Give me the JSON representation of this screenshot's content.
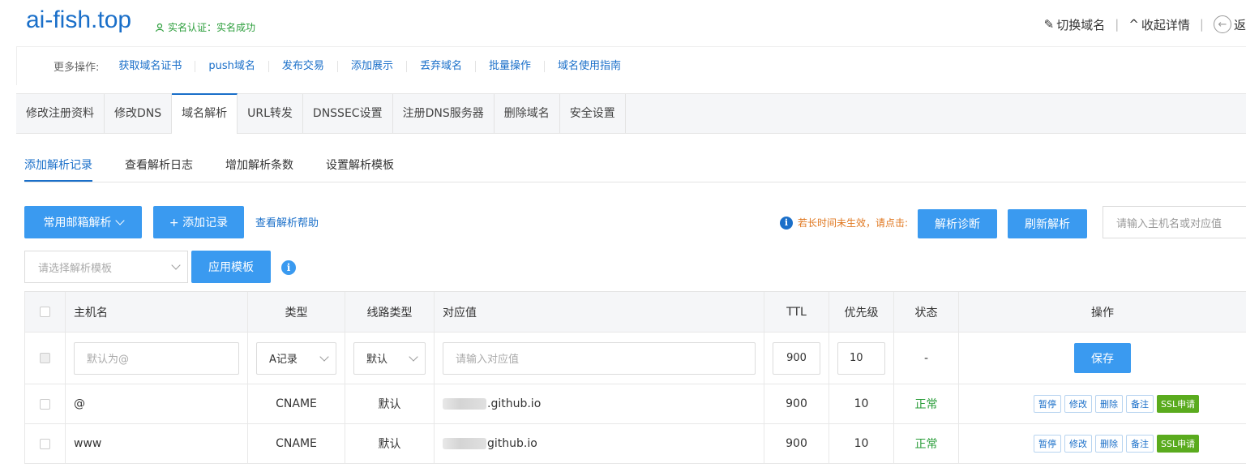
{
  "header": {
    "domain": "ai-fish.top",
    "verify_label": "实名认证：实名成功",
    "switch_domain": "切换域名",
    "collapse": "收起详情",
    "back": "返"
  },
  "more_ops": {
    "label": "更多操作:",
    "links": [
      "获取域名证书",
      "push域名",
      "发布交易",
      "添加展示",
      "丢弃域名",
      "批量操作",
      "域名使用指南"
    ]
  },
  "tabs": [
    "修改注册资料",
    "修改DNS",
    "域名解析",
    "URL转发",
    "DNSSEC设置",
    "注册DNS服务器",
    "删除域名",
    "安全设置"
  ],
  "active_tab": "域名解析",
  "subtabs": [
    "添加解析记录",
    "查看解析日志",
    "增加解析条数",
    "设置解析模板"
  ],
  "toolbar": {
    "email_btn": "常用邮箱解析",
    "add_btn": "+ 添加记录",
    "help_link": "查看解析帮助",
    "hint": "若长时间未生效，请点击:",
    "diag_btn": "解析诊断",
    "refresh_btn": "刷新解析",
    "search_placeholder": "请输入主机名或对应值",
    "template_placeholder": "请选择解析模板",
    "apply_btn": "应用模板"
  },
  "table": {
    "headers": {
      "host": "主机名",
      "type": "类型",
      "line": "线路类型",
      "value": "对应值",
      "ttl": "TTL",
      "priority": "优先级",
      "status": "状态",
      "ops": "操作"
    },
    "edit_row": {
      "host_placeholder": "默认为@",
      "type": "A记录",
      "line": "默认",
      "value_placeholder": "请输入对应值",
      "ttl": "900",
      "priority": "10",
      "status": "-",
      "save": "保存"
    },
    "rows": [
      {
        "host": "@",
        "type": "CNAME",
        "line": "默认",
        "value": ".github.io",
        "ttl": "900",
        "priority": "10",
        "status": "正常"
      },
      {
        "host": "www",
        "type": "CNAME",
        "line": "默认",
        "value": "github.io",
        "ttl": "900",
        "priority": "10",
        "status": "正常"
      }
    ],
    "op_labels": {
      "pause": "暂停",
      "edit": "修改",
      "delete": "删除",
      "note": "备注",
      "ssl": "SSL申请"
    }
  },
  "colors": {
    "primary": "#3a9af0",
    "link": "#1a6fc9",
    "success": "#2a9d3a",
    "warning": "#e0771f",
    "ssl": "#5aab1e"
  }
}
